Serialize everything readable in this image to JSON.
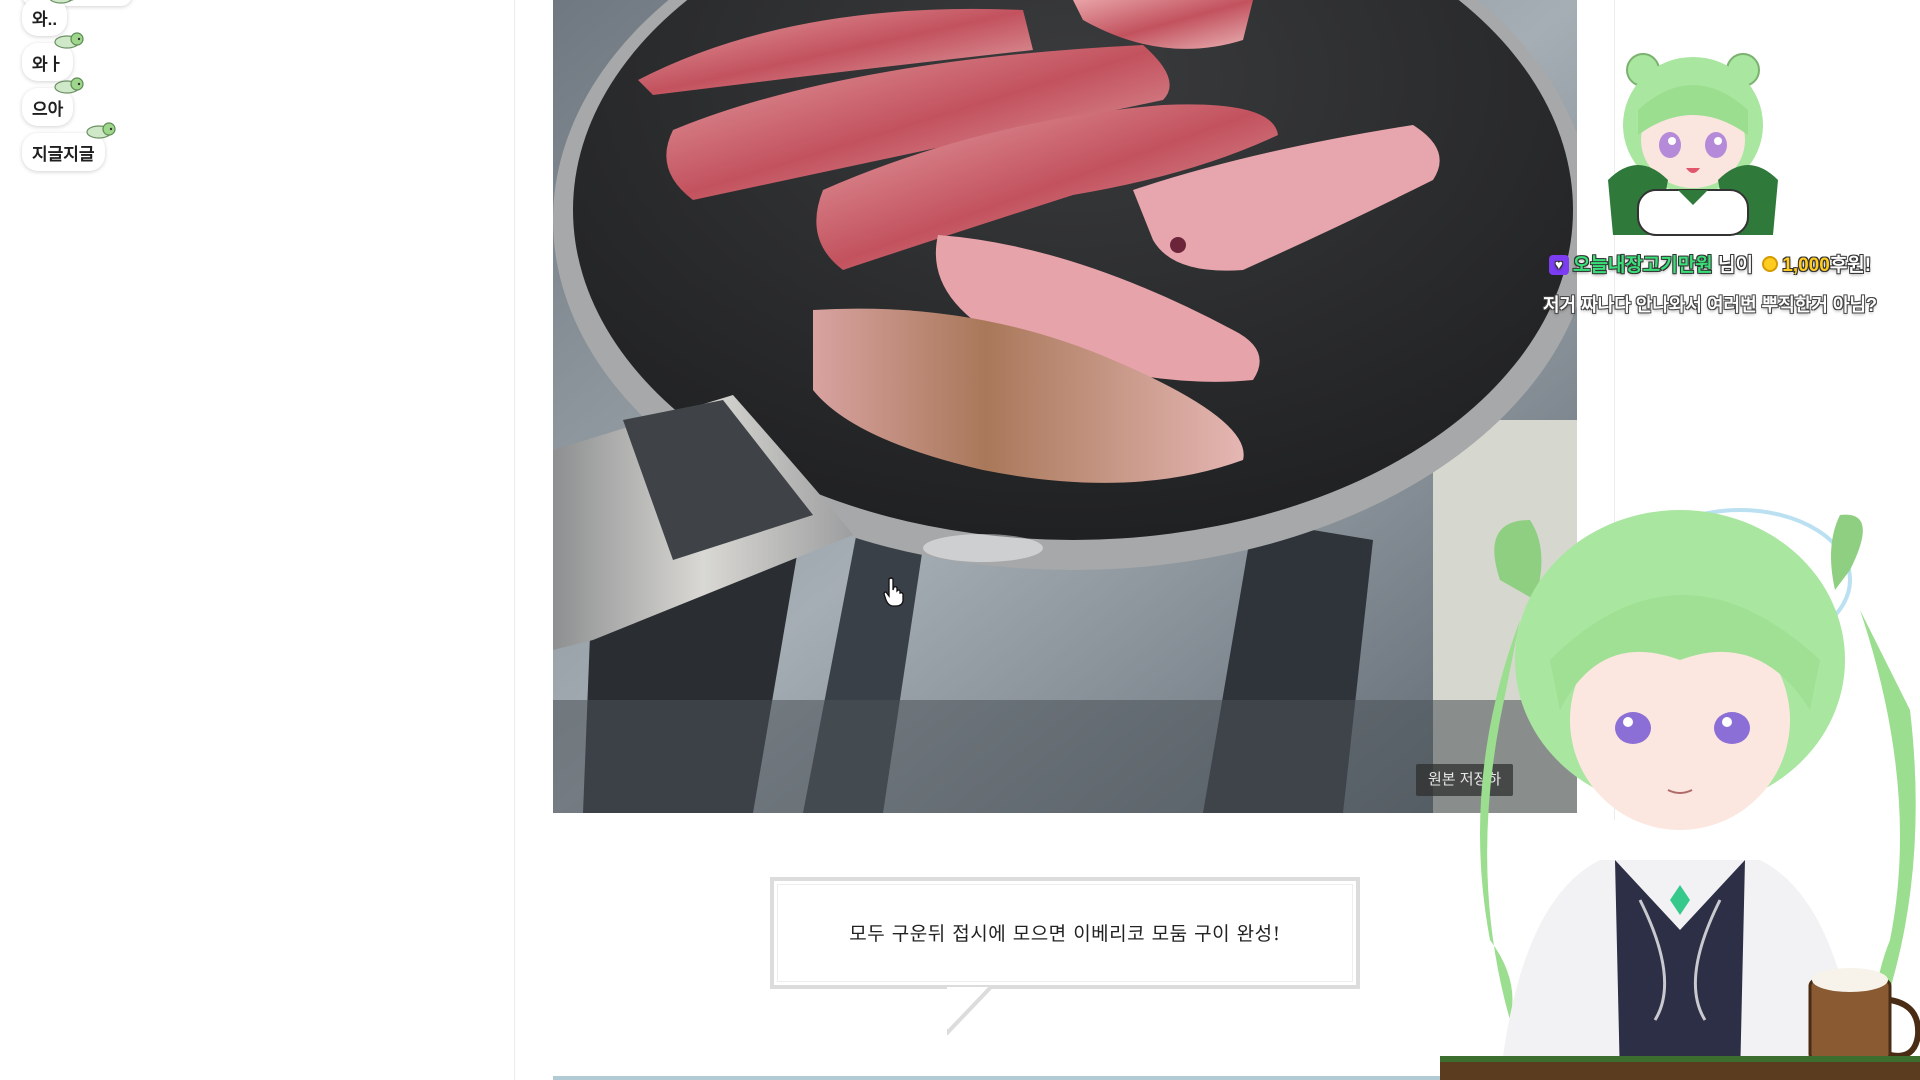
{
  "chat": {
    "messages": [
      {
        "text": "와.."
      },
      {
        "text": "와ㅏ"
      },
      {
        "text": "으아"
      },
      {
        "text": "지글지글"
      }
    ]
  },
  "post": {
    "save_original_label": "원본 저장하",
    "caption": "모두 구운뒤 접시에 모으면 이베리코 모둠 구이 완성!"
  },
  "stream_overlay": {
    "donation": {
      "donor": "오늘내장고기만원",
      "suffix": "님이",
      "amount": "1,000",
      "unit": "후원!"
    },
    "donation_message": "저거 짜나다 안나와서 여러번 뿌직한거 아님?"
  },
  "colors": {
    "donor_name": "#39e07a",
    "donation_amount": "#ffcc1f",
    "donation_heart": "#7c3cf2",
    "caption_border": "#dcdcdc"
  },
  "icons": [
    "heart-icon",
    "coin-icon",
    "cursor-icon",
    "mascot-chibi-icon",
    "vtuber-avatar"
  ]
}
